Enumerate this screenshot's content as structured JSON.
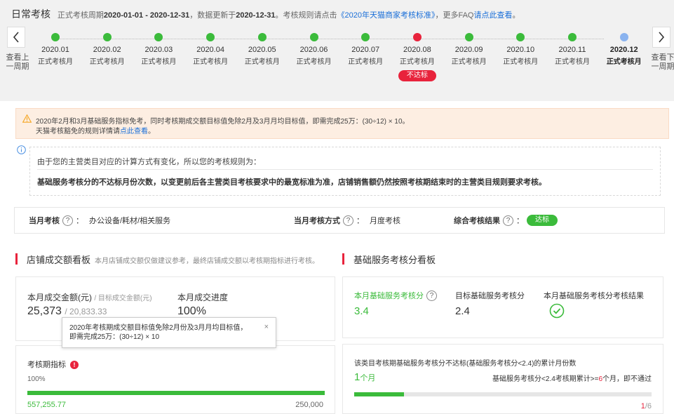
{
  "header": {
    "title": "日常考核",
    "period_prefix": "正式考核周期",
    "period": "2020-01-01 - 2020-12-31",
    "update_prefix": "，数据更新于",
    "update_date": "2020-12-31",
    "rules_text": "。考核规则请点击",
    "rules_link": "《2020年天猫商家考核标准》",
    "faq_text": "，更多FAQ",
    "faq_link": "请点此查看",
    "faq_end": "。"
  },
  "nav": {
    "prev_label": "查看上一周期",
    "next_label": "查看下一周期"
  },
  "timeline": {
    "months": [
      {
        "date": "2020.01",
        "label": "正式考核月",
        "status": "pass"
      },
      {
        "date": "2020.02",
        "label": "正式考核月",
        "status": "pass"
      },
      {
        "date": "2020.03",
        "label": "正式考核月",
        "status": "pass"
      },
      {
        "date": "2020.04",
        "label": "正式考核月",
        "status": "pass"
      },
      {
        "date": "2020.05",
        "label": "正式考核月",
        "status": "pass"
      },
      {
        "date": "2020.06",
        "label": "正式考核月",
        "status": "pass"
      },
      {
        "date": "2020.07",
        "label": "正式考核月",
        "status": "pass"
      },
      {
        "date": "2020.08",
        "label": "正式考核月",
        "status": "fail",
        "badge": "不达标"
      },
      {
        "date": "2020.09",
        "label": "正式考核月",
        "status": "pass"
      },
      {
        "date": "2020.10",
        "label": "正式考核月",
        "status": "pass"
      },
      {
        "date": "2020.11",
        "label": "正式考核月",
        "status": "pass"
      },
      {
        "date": "2020.12",
        "label": "正式考核月",
        "status": "current"
      }
    ]
  },
  "notice": {
    "line1": "2020年2月和3月基础服务指标免考，同时考核期成交额目标值免除2月及3月月均目标值，即需完成25万：(30÷12) × 10。",
    "line2_prefix": "天猫考核豁免的规则详情请",
    "line2_link": "点此查看",
    "line2_end": "。"
  },
  "info": {
    "line1": "由于您的主营类目对应的计算方式有变化，所以您的考核规则为：",
    "line2": "基础服务考核分的不达标月份次数，以变更前后各主营类目考核要求中的最宽标准为准，店铺销售额仍然按照考核期结束时的主营类目规则要求考核。"
  },
  "summary": {
    "month_label": "当月考核",
    "month_value": "办公设备/耗材/相关服务",
    "method_label": "当月考核方式",
    "method_value": "月度考核",
    "result_label": "综合考核结果",
    "result_value": "达标"
  },
  "left_section": {
    "title": "店铺成交额看板",
    "note": "本月店铺成交额仅做建议参考，最终店铺成交额以考核期指标进行考核。",
    "amount_label": "本月成交金额(元)",
    "target_label": "/ 目标成交金额(元)",
    "amount": "25,373",
    "target": "/ 20,833.33",
    "progress_label": "本月成交进度",
    "progress_value": "100%",
    "tooltip": "2020年考核期成交额目标值免除2月份及3月月均目标值，\n即需完成25万：(30÷12) × 10",
    "tooltip_close": "×",
    "period_label": "考核期指标",
    "period_percent": "100%",
    "period_progress": 1.0,
    "period_amount": "557,255.77",
    "period_target": "250,000"
  },
  "right_section": {
    "title": "基础服务考核分看板",
    "score_label": "本月基础服务考核分",
    "score_value": "3.4",
    "target_label": "目标基础服务考核分",
    "target_value": "2.4",
    "result_label": "本月基础服务考核分考核结果",
    "fail_count_label": "该类目考核期基础服务考核分不达标(基础服务考核分<2.4)的累计月份数",
    "fail_count_value": "1",
    "fail_count_unit": "个月",
    "rule_prefix": "基础服务考核分<2.4考核期累计>=",
    "rule_num": "6",
    "rule_suffix": "个月，即不通过",
    "fraction_num": "1",
    "fraction_den": "/6",
    "fail_progress": 0.1667
  },
  "colors": {
    "pass_green": "#3bbb3b",
    "fail_red": "#e8233c",
    "current_blue": "#8ab3ef",
    "link_blue": "#1a6fd8"
  }
}
